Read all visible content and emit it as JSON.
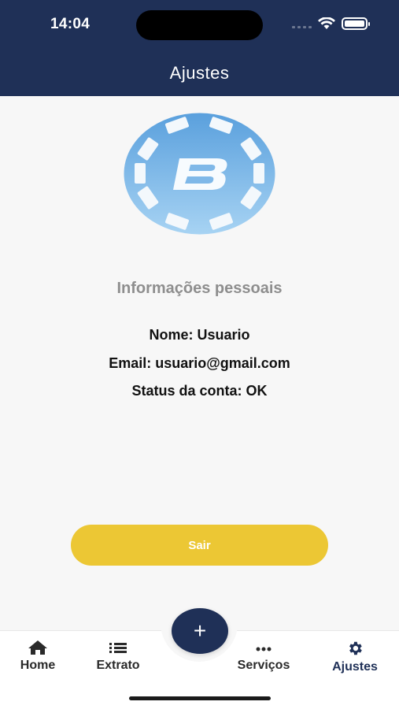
{
  "status_bar": {
    "time": "14:04"
  },
  "header": {
    "title": "Ajustes"
  },
  "profile": {
    "section_title": "Informações pessoais",
    "name_line": "Nome: Usuario",
    "email_line": "Email: usuario@gmail.com",
    "status_line": "Status da conta: OK"
  },
  "actions": {
    "logout_label": "Sair"
  },
  "fab": {
    "label": "+"
  },
  "tabbar": {
    "items": [
      {
        "label": "Home",
        "icon": "home-icon"
      },
      {
        "label": "Extrato",
        "icon": "list-icon"
      },
      {
        "label": "Serviços",
        "icon": "more-icon"
      },
      {
        "label": "Ajustes",
        "icon": "gear-icon",
        "active": true
      }
    ]
  },
  "colors": {
    "header": "#1f3057",
    "logout_button": "#ecc734",
    "background": "#f7f7f7"
  }
}
